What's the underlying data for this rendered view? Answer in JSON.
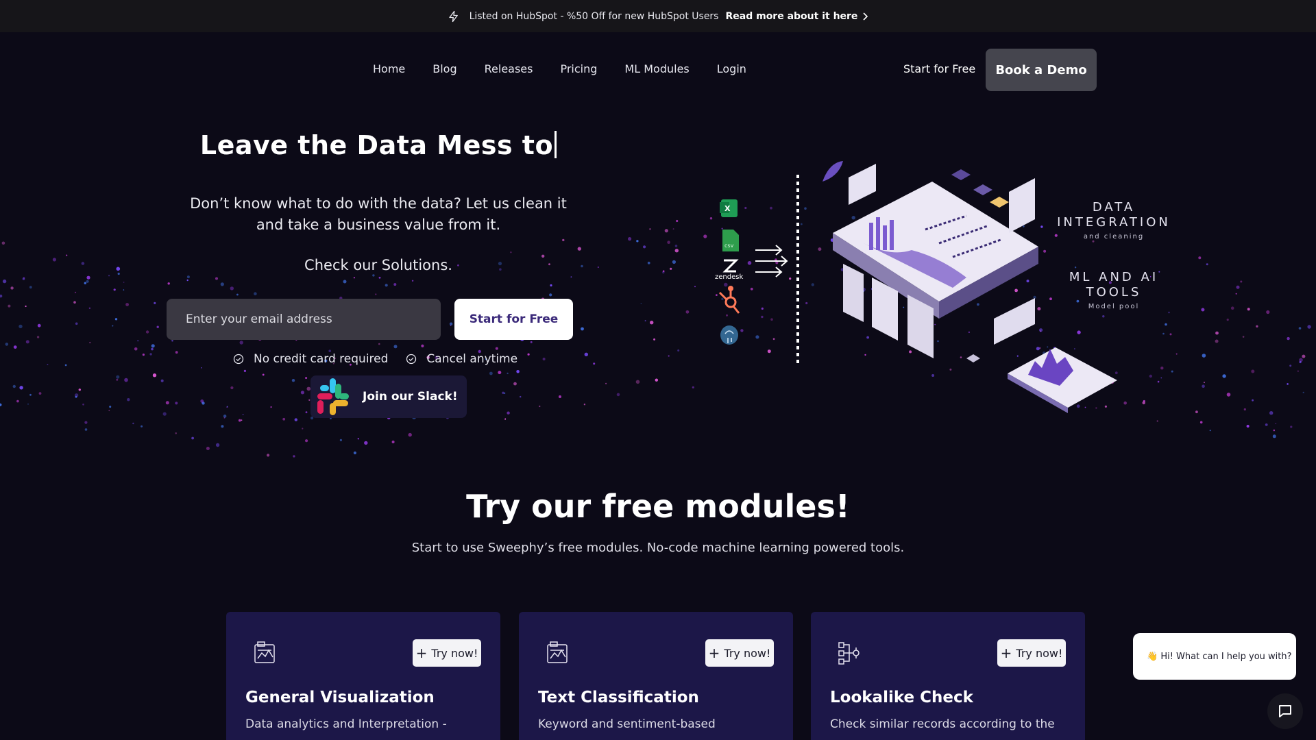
{
  "announcement": {
    "text": "Listed on HubSpot - %50 Off for new HubSpot Users",
    "link": "Read more about it here"
  },
  "nav": {
    "items": [
      "Home",
      "Blog",
      "Releases",
      "Pricing",
      "ML Modules",
      "Login"
    ],
    "start_free": "Start for Free",
    "book_demo": "Book a Demo"
  },
  "hero": {
    "title": "Leave the Data Mess to",
    "subtitle": "Don’t know what to do with the data? Let us clean it and take a business value from it.",
    "check": "Check our Solutions.",
    "email_placeholder": "Enter your email address",
    "start_button": "Start for Free",
    "perks": [
      "No credit card required",
      "Cancel anytime"
    ],
    "slack": "Join our Slack!"
  },
  "illustration": {
    "label1_big": "DATA INTEGRATION",
    "label1_small": "and cleaning",
    "label2_big": "ML AND AI TOOLS",
    "label2_small": "Model pool",
    "source_icons": [
      "excel-icon",
      "csv-icon",
      "zendesk-icon",
      "hubspot-icon",
      "postgresql-icon"
    ],
    "csv_text": "csv",
    "zendesk_text": "zendesk"
  },
  "modules": {
    "title": "Try our free modules!",
    "subtitle": "Start to use Sweephy’s free modules. No-code machine learning powered tools.",
    "cards": [
      {
        "title": "General Visualization",
        "desc": "Data analytics and Interpretation -",
        "button": "Try now!",
        "icon": "chart-icon"
      },
      {
        "title": "Text Classification",
        "desc": "Keyword and sentiment-based",
        "button": "Try now!",
        "icon": "chart-icon"
      },
      {
        "title": "Lookalike Check",
        "desc": "Check similar records according to the",
        "button": "Try now!",
        "icon": "flow-icon"
      }
    ]
  },
  "chat": {
    "greeting": "👋 Hi! What can I help you with?"
  },
  "colors": {
    "background": "#0c0a17",
    "card": "#1c1748",
    "accent": "#3b2a7a"
  }
}
